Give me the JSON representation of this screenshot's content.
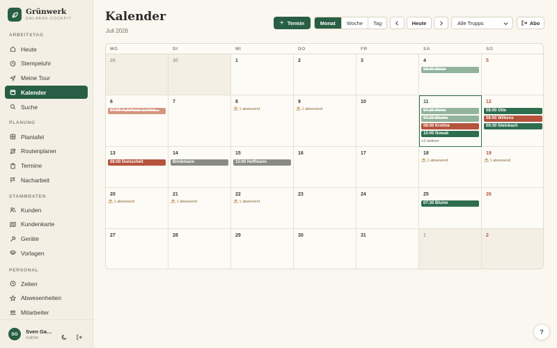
{
  "brand": {
    "name": "Grünwerk",
    "sub": "GALABAU-COCKPIT"
  },
  "sidebar": {
    "sections": [
      {
        "label": "ARBEITSTAG",
        "items": [
          {
            "label": "Heute",
            "icon": "home-icon"
          },
          {
            "label": "Stempeluhr",
            "icon": "clock-icon"
          },
          {
            "label": "Meine Tour",
            "icon": "navigation-icon"
          },
          {
            "label": "Kalender",
            "icon": "calendar-icon",
            "active": true
          },
          {
            "label": "Suche",
            "icon": "search-icon"
          }
        ]
      },
      {
        "label": "PLANUNG",
        "items": [
          {
            "label": "Plantafel",
            "icon": "grid-icon"
          },
          {
            "label": "Routenplaner",
            "icon": "route-icon"
          },
          {
            "label": "Termine",
            "icon": "clipboard-icon"
          },
          {
            "label": "Nacharbeit",
            "icon": "flag-icon"
          }
        ]
      },
      {
        "label": "STAMMDATEN",
        "items": [
          {
            "label": "Kunden",
            "icon": "users-icon"
          },
          {
            "label": "Kundenkarte",
            "icon": "map-icon"
          },
          {
            "label": "Geräte",
            "icon": "hammer-icon"
          },
          {
            "label": "Vorlagen",
            "icon": "layers-icon"
          }
        ]
      },
      {
        "label": "PERSONAL",
        "items": [
          {
            "label": "Zeiten",
            "icon": "clock-icon"
          },
          {
            "label": "Abwesenheiten",
            "icon": "star-icon"
          },
          {
            "label": "Mitarbeiter",
            "icon": "team-icon"
          }
        ]
      }
    ]
  },
  "user": {
    "initials": "SG",
    "name": "Sven Ga…",
    "role": "Admin"
  },
  "header": {
    "title": "Kalender",
    "subtitle": "Juli 2026",
    "new_label": "Termin",
    "views": [
      "Monat",
      "Woche",
      "Tag"
    ],
    "today_label": "Heute",
    "filter_value": "Alle Trupps",
    "abo_label": "Abo"
  },
  "calendar": {
    "weekdays": [
      "MO",
      "DI",
      "MI",
      "DO",
      "FR",
      "SA",
      "SO"
    ],
    "absent_label": "1 abwesend",
    "weeks": [
      [
        {
          "d": "29",
          "out": true
        },
        {
          "d": "30",
          "out": true
        },
        {
          "d": "1"
        },
        {
          "d": "2"
        },
        {
          "d": "3"
        },
        {
          "d": "4",
          "events": [
            {
              "t": "08:00 Meier",
              "s": "done-g"
            }
          ]
        },
        {
          "d": "5",
          "sun": true
        }
      ],
      [
        {
          "d": "6",
          "events": [
            {
              "t": "07:00 Autohaus Levien…",
              "s": "done-r"
            }
          ]
        },
        {
          "d": "7"
        },
        {
          "d": "8",
          "absent": true
        },
        {
          "d": "9",
          "absent": true
        },
        {
          "d": "10"
        },
        {
          "d": "11",
          "today": true,
          "events": [
            {
              "t": "07:30 Meier",
              "s": "done-g"
            },
            {
              "t": "07:30 Blume",
              "s": "done-g"
            },
            {
              "t": "08:00 Krohne",
              "s": "red"
            },
            {
              "t": "10:00 Nowak",
              "s": "green"
            }
          ],
          "more": "+2 weitere"
        },
        {
          "d": "12",
          "sun": true,
          "events": [
            {
              "t": "08:00 Otte",
              "s": "green"
            },
            {
              "t": "08:00 Wilkens",
              "s": "red"
            },
            {
              "t": "09:30 Steinbach",
              "s": "green"
            }
          ]
        }
      ],
      [
        {
          "d": "13",
          "events": [
            {
              "t": "08:00 Domscheit",
              "s": "red"
            }
          ]
        },
        {
          "d": "14",
          "events": [
            {
              "t": "Brinkmann",
              "s": "grey"
            }
          ]
        },
        {
          "d": "15",
          "events": [
            {
              "t": "15:00 Hoffmann",
              "s": "grey"
            }
          ]
        },
        {
          "d": "16"
        },
        {
          "d": "17"
        },
        {
          "d": "18",
          "absent": true
        },
        {
          "d": "19",
          "sun": true,
          "absent": true
        }
      ],
      [
        {
          "d": "20",
          "absent": true
        },
        {
          "d": "21",
          "absent": true
        },
        {
          "d": "22",
          "absent": true
        },
        {
          "d": "23"
        },
        {
          "d": "24"
        },
        {
          "d": "25",
          "events": [
            {
              "t": "07:30 Blume",
              "s": "green"
            }
          ]
        },
        {
          "d": "26",
          "sun": true
        }
      ],
      [
        {
          "d": "27"
        },
        {
          "d": "28"
        },
        {
          "d": "29"
        },
        {
          "d": "30"
        },
        {
          "d": "31"
        },
        {
          "d": "1",
          "out": true
        },
        {
          "d": "2",
          "out": true,
          "sun": true
        }
      ]
    ]
  },
  "help_label": "?"
}
